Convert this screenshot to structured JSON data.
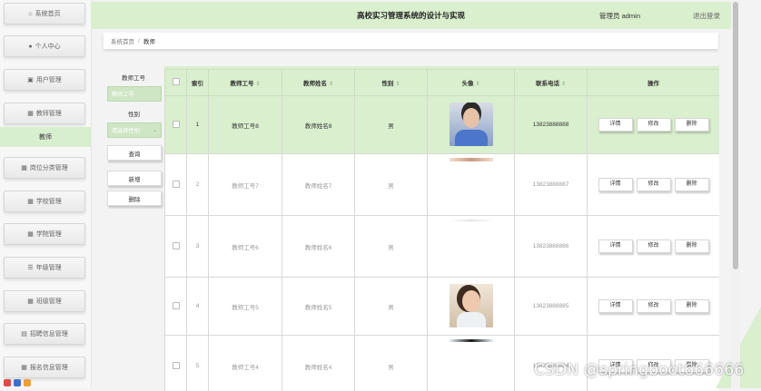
{
  "app": {
    "title": "高校实习管理系统的设计与实现",
    "user_label": "管理员 admin",
    "logout_label": "退出登录"
  },
  "sidebar": {
    "items": [
      {
        "label": "系统首页",
        "icon": "home-icon"
      },
      {
        "label": "个人中心",
        "icon": "user-icon"
      },
      {
        "label": "用户管理",
        "icon": "users-icon"
      },
      {
        "label": "教师管理",
        "icon": "grid-icon"
      },
      {
        "label": "岗位分类管理",
        "icon": "grid-icon"
      },
      {
        "label": "学校管理",
        "icon": "grid-icon"
      },
      {
        "label": "学院管理",
        "icon": "grid-icon"
      },
      {
        "label": "年级管理",
        "icon": "list-icon"
      },
      {
        "label": "班级管理",
        "icon": "grid-icon"
      },
      {
        "label": "招聘信息管理",
        "icon": "doc-icon"
      },
      {
        "label": "报名信息管理",
        "icon": "grid-icon"
      }
    ],
    "active_sub": "教师"
  },
  "breadcrumb": {
    "home": "系统首页",
    "sep": "/",
    "current": "教师"
  },
  "search": {
    "label_id": "教师工号",
    "id_placeholder": "教师工号",
    "label_gender": "性别",
    "gender_placeholder": "请选择性别",
    "query_label": "查询",
    "add_label": "新增",
    "delete_label": "删除"
  },
  "table": {
    "headers": [
      "索引",
      "教师工号",
      "教师姓名",
      "性别",
      "头像",
      "联系电话",
      "操作"
    ],
    "rows": [
      {
        "idx": "1",
        "id": "教师工号8",
        "name": "教师姓名8",
        "gender": "男",
        "phone": "13823888888"
      },
      {
        "idx": "2",
        "id": "教师工号7",
        "name": "教师姓名7",
        "gender": "男",
        "phone": "13823888887"
      },
      {
        "idx": "3",
        "id": "教师工号6",
        "name": "教师姓名6",
        "gender": "男",
        "phone": "13823888886"
      },
      {
        "idx": "4",
        "id": "教师工号5",
        "name": "教师姓名5",
        "gender": "男",
        "phone": "13823888885"
      },
      {
        "idx": "5",
        "id": "教师工号4",
        "name": "教师姓名4",
        "gender": "男",
        "phone": "13823888884"
      }
    ],
    "actions": {
      "detail": "详情",
      "edit": "修改",
      "delete": "删除"
    }
  },
  "watermark": "CSDN @springboot666666",
  "colors": {
    "accent": "#d9efcd",
    "accent_border": "#c9dfbf"
  }
}
